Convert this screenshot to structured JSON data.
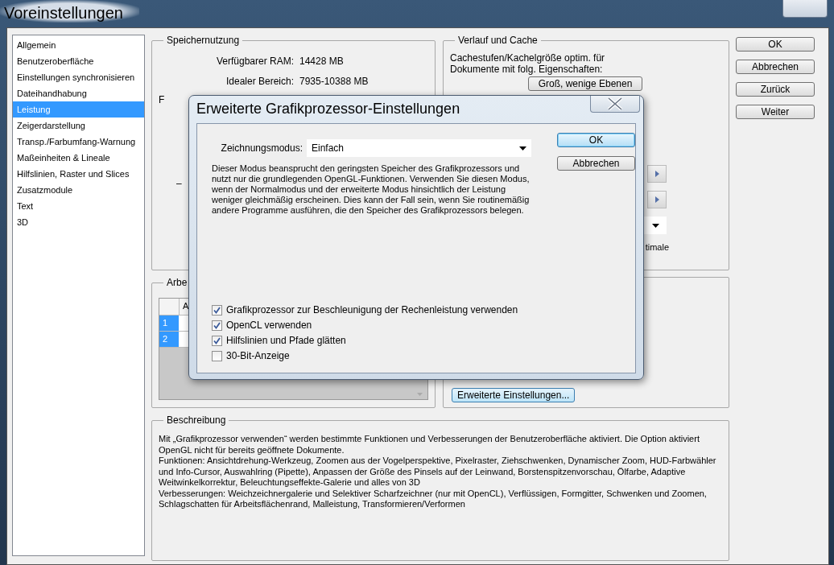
{
  "window": {
    "title": "Voreinstellungen"
  },
  "sidebar": {
    "items": [
      {
        "label": "Allgemein",
        "selected": false
      },
      {
        "label": "Benutzeroberfläche",
        "selected": false
      },
      {
        "label": "Einstellungen synchronisieren",
        "selected": false
      },
      {
        "label": "Dateihandhabung",
        "selected": false
      },
      {
        "label": "Leistung",
        "selected": true
      },
      {
        "label": "Zeigerdarstellung",
        "selected": false
      },
      {
        "label": "Transp./Farbumfang-Warnung",
        "selected": false
      },
      {
        "label": "Maßeinheiten & Lineale",
        "selected": false
      },
      {
        "label": "Hilfslinien, Raster und Slices",
        "selected": false
      },
      {
        "label": "Zusatzmodule",
        "selected": false
      },
      {
        "label": "Text",
        "selected": false
      },
      {
        "label": "3D",
        "selected": false
      }
    ]
  },
  "memory": {
    "title": "Speichernutzung",
    "rows": [
      {
        "label": "Verfügbarer RAM:",
        "value": "14428 MB"
      },
      {
        "label": "Idealer Bereich:",
        "value": "7935-10388 MB"
      }
    ],
    "partial_label": "F",
    "slider_min": "–"
  },
  "history": {
    "title": "Verlauf und Cache",
    "description": "Cachestufen/Kachelgröße optim. für Dokumente mit folg. Eigenschaften:",
    "preset_button": "Groß, wenige Ebenen",
    "partial_text": "timale"
  },
  "scratch": {
    "title": "Arbe",
    "column_1": "A",
    "rows": [
      "1",
      "2"
    ]
  },
  "gpu": {
    "button": "Erweiterte Einstellungen..."
  },
  "description": {
    "title": "Beschreibung",
    "paragraphs": [
      "Mit „Grafikprozessor verwenden“ werden bestimmte Funktionen und Verbesserungen der Benutzeroberfläche aktiviert. Die Option aktiviert OpenGL nicht für bereits geöffnete Dokumente.",
      "Funktionen: Ansichtdrehung-Werkzeug, Zoomen aus der Vogelperspektive, Pixelraster, Ziehschwenken, Dynamischer Zoom, HUD-Farbwähler und Info-Cursor, Auswahlring (Pipette), Anpassen der Größe des Pinsels auf der Leinwand, Borstenspitzenvorschau, Ölfarbe, Adaptive Weitwinkelkorrektur, Beleuchtungseffekte-Galerie und alles von 3D",
      "Verbesserungen: Weichzeichnergalerie und Selektiver Scharfzeichner (nur mit OpenCL), Verflüssigen, Formgitter, Schwenken und Zoomen, Schlagschatten für Arbeitsflächenrand, Malleistung, Transformieren/Verformen"
    ]
  },
  "buttons": [
    "OK",
    "Abbrechen",
    "Zurück",
    "Weiter"
  ],
  "dialog": {
    "title": "Erweiterte Grafikprozessor-Einstellungen",
    "mode_label": "Zeichnungsmodus:",
    "mode_value": "Einfach",
    "text": "Dieser Modus beansprucht den geringsten Speicher des Grafikprozessors und nutzt nur die grundlegenden OpenGL-Funktionen. Verwenden Sie diesen Modus, wenn der Normalmodus und der erweiterte Modus hinsichtlich der Leistung weniger gleichmäßig erscheinen. Dies kann der Fall sein, wenn Sie routinemäßig andere Programme ausführen, die den Speicher des Grafikprozessors belegen.",
    "buttons": [
      {
        "label": "OK",
        "default": true
      },
      {
        "label": "Abbrechen",
        "default": false
      }
    ],
    "checkboxes": [
      {
        "label": "Grafikprozessor zur Beschleunigung der Rechenleistung verwenden",
        "checked": true
      },
      {
        "label": "OpenCL verwenden",
        "checked": true
      },
      {
        "label": "Hilfslinien und Pfade glätten",
        "checked": true
      },
      {
        "label": "30-Bit-Anzeige",
        "checked": false
      }
    ]
  }
}
